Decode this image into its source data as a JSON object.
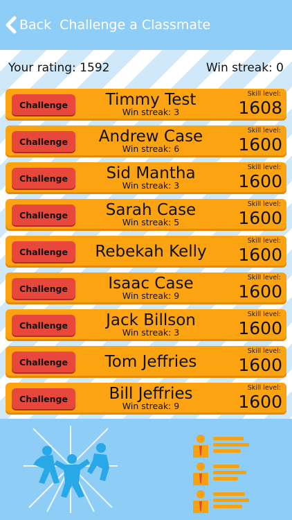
{
  "header": {
    "back_label": "Back",
    "title": "Challenge a Classmate"
  },
  "stats": {
    "rating_text": "Your rating: 1592",
    "streak_text": "Win streak: 0"
  },
  "labels": {
    "skill_level": "Skill level:",
    "challenge": "Challenge"
  },
  "classmates": [
    {
      "name": "Timmy Test",
      "win_streak": "Win streak: 3",
      "skill": "1608"
    },
    {
      "name": "Andrew Case",
      "win_streak": "Win streak: 6",
      "skill": "1600"
    },
    {
      "name": "Sid Mantha",
      "win_streak": "Win streak: 3",
      "skill": "1600"
    },
    {
      "name": "Sarah Case",
      "win_streak": "Win streak: 5",
      "skill": "1600"
    },
    {
      "name": "Rebekah Kelly",
      "win_streak": "",
      "skill": "1600"
    },
    {
      "name": "Isaac Case",
      "win_streak": "Win streak: 9",
      "skill": "1600"
    },
    {
      "name": "Jack Billson",
      "win_streak": "Win streak: 3",
      "skill": "1600"
    },
    {
      "name": "Tom Jeffries",
      "win_streak": "",
      "skill": "1600"
    },
    {
      "name": "Bill Jeffries",
      "win_streak": "Win streak: 9",
      "skill": "1600"
    }
  ],
  "icons": {
    "back": "chevron-left-icon",
    "fight": "fighting-figures-icon",
    "leaderboard": "leaderboard-icon"
  },
  "colors": {
    "background": "#8ecdf5",
    "row": "#fca312",
    "button": "#e8473b"
  }
}
